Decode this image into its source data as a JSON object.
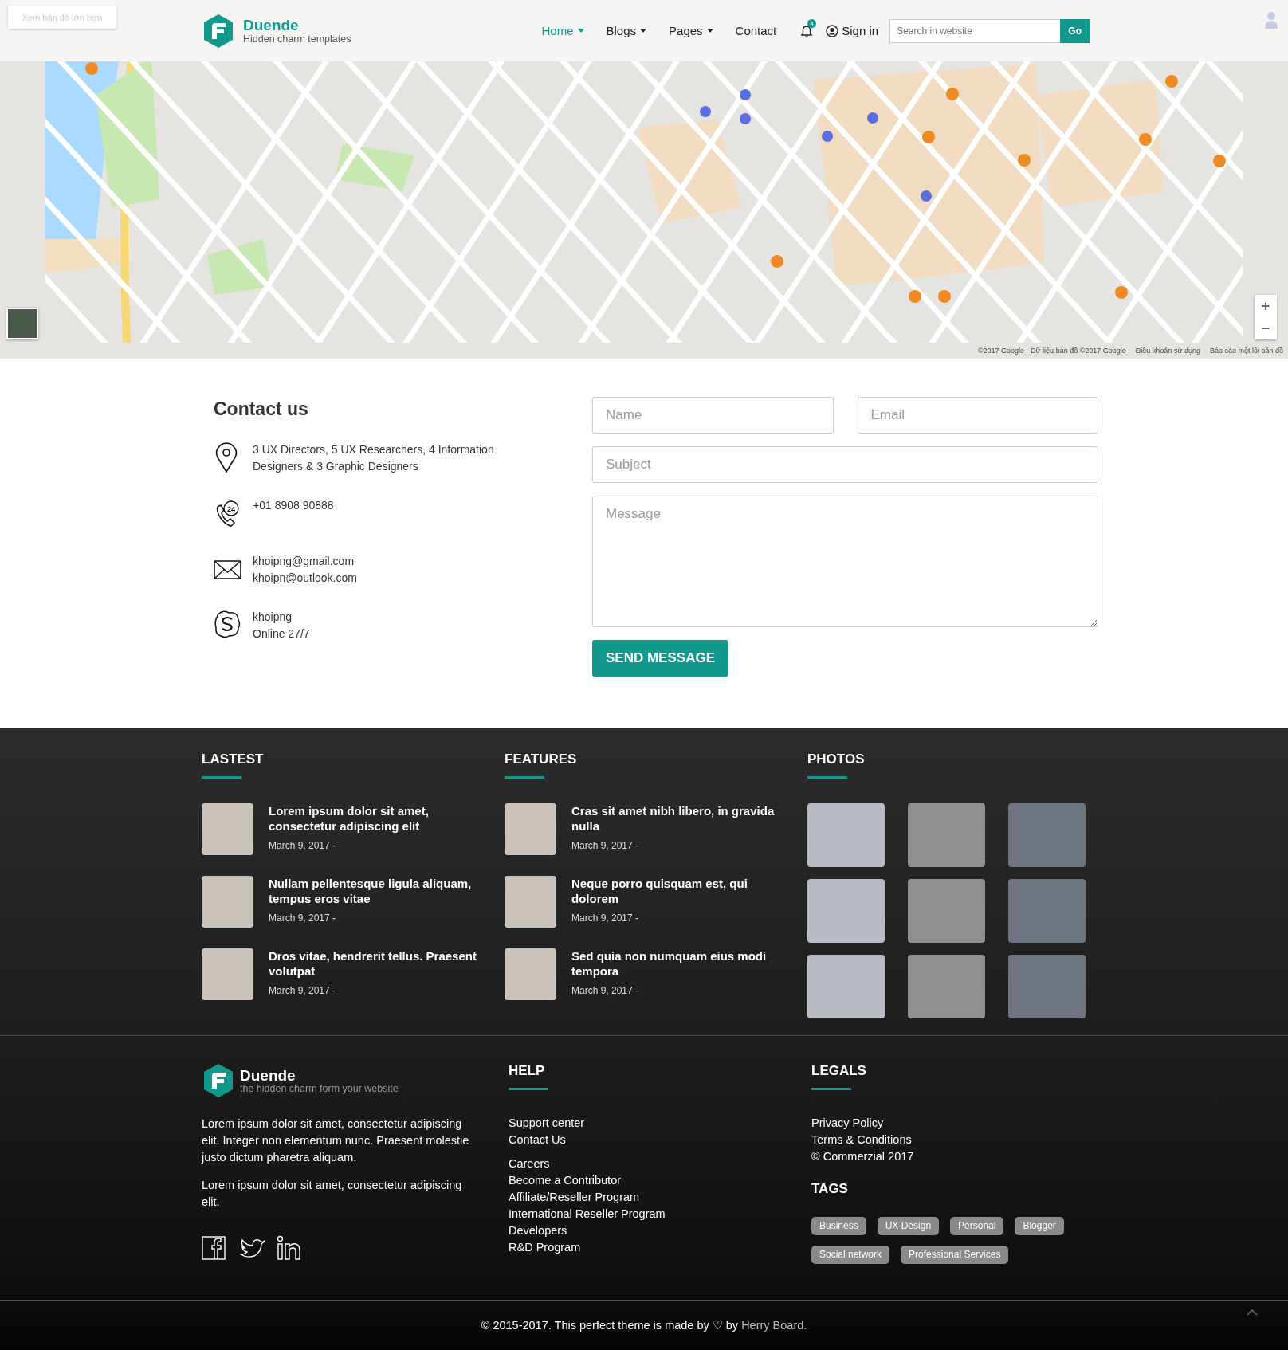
{
  "header": {
    "larger_map_link": "Xem bản đồ lớn hơn",
    "brand": "Duende",
    "tagline": "Hidden charm templates",
    "nav": [
      {
        "label": "Home",
        "selected": true,
        "dropdown": true
      },
      {
        "label": "Blogs",
        "selected": false,
        "dropdown": true
      },
      {
        "label": "Pages",
        "selected": false,
        "dropdown": true
      },
      {
        "label": "Contact",
        "selected": false,
        "dropdown": false
      }
    ],
    "notification_count": "4",
    "sign_in": "Sign in",
    "search": {
      "placeholder": "Search in website",
      "button": "Go"
    }
  },
  "map": {
    "zoom_in": "+",
    "zoom_out": "−",
    "attribution": [
      "©2017 Google - Dữ liệu bản đồ ©2017 Google",
      "Điều khoản sử dụng",
      "Báo cáo một lỗi bản đồ"
    ]
  },
  "contact": {
    "title": "Contact us",
    "items": [
      {
        "kind": "address",
        "lines": [
          "3 UX Directors, 5 UX Researchers, 4 Information Designers & 3 Graphic Designers"
        ]
      },
      {
        "kind": "phone",
        "icon_text": "24",
        "lines": [
          "+01 8908 90888"
        ]
      },
      {
        "kind": "email",
        "lines": [
          "khoipng@gmail.com",
          "khoipn@outlook.com"
        ]
      },
      {
        "kind": "skype",
        "lines": [
          "khoipng",
          "Online 27/7"
        ]
      }
    ]
  },
  "form": {
    "rows": [
      [
        {
          "kind": "input",
          "placeholder": "Name"
        },
        {
          "kind": "input",
          "placeholder": "Email"
        }
      ],
      [
        {
          "kind": "input",
          "placeholder": "Subject"
        }
      ],
      [
        {
          "kind": "textarea",
          "placeholder": "Message"
        }
      ]
    ],
    "button": "SEND MESSAGE"
  },
  "footer": {
    "columns": [
      {
        "title": "LASTEST",
        "posts": [
          {
            "title": "Lorem ipsum dolor sit amet, consectetur adipiscing elit",
            "date": "March 9, 2017 -"
          },
          {
            "title": "Nullam pellentesque ligula aliquam, tempus eros vitae",
            "date": "March 9, 2017 -"
          },
          {
            "title": "Dros vitae, hendrerit tellus. Praesent volutpat",
            "date": "March 9, 2017 -"
          }
        ]
      },
      {
        "title": "FEATURES",
        "posts": [
          {
            "title": "Cras sit amet nibh libero, in gravida nulla",
            "date": "March 9, 2017 -"
          },
          {
            "title": "Neque porro quisquam est, qui dolorem",
            "date": "March 9, 2017 -"
          },
          {
            "title": "Sed quia non numquam eius modi tempora",
            "date": "March 9, 2017 -"
          }
        ]
      }
    ],
    "photos": {
      "title": "PHOTOS"
    },
    "about": {
      "brand": "Duende",
      "tagline": "the hidden charm form your website",
      "paragraphs": [
        "Lorem ipsum dolor sit amet, consectetur adipiscing elit. Integer non elementum nunc. Praesent molestie justo dictum pharetra aliquam.",
        "Lorem ipsum dolor sit amet, consectetur adipiscing elit."
      ],
      "social": [
        {
          "kind": "facebook"
        },
        {
          "kind": "twitter"
        },
        {
          "kind": "linkedin"
        }
      ]
    },
    "help": {
      "title": "HELP",
      "groups": [
        [
          "Support center",
          "Contact Us"
        ],
        [
          "Careers",
          "Become a Contributor",
          "Affiliate/Reseller Program",
          "International Reseller Program",
          "Developers",
          "R&D Program"
        ]
      ]
    },
    "legals": {
      "title": "LEGALS",
      "links": [
        "Privacy Policy",
        "Terms & Conditions"
      ],
      "copyright": "© Commerzial 2017"
    },
    "tags": {
      "title": "TAGS",
      "items": [
        "Business",
        "UX Design",
        "Personal",
        "Blogger",
        "Social network",
        "Professional Services"
      ]
    },
    "credit": "© 2015-2017. This perfect theme is made by ♡ by",
    "author": "Herry Board."
  }
}
